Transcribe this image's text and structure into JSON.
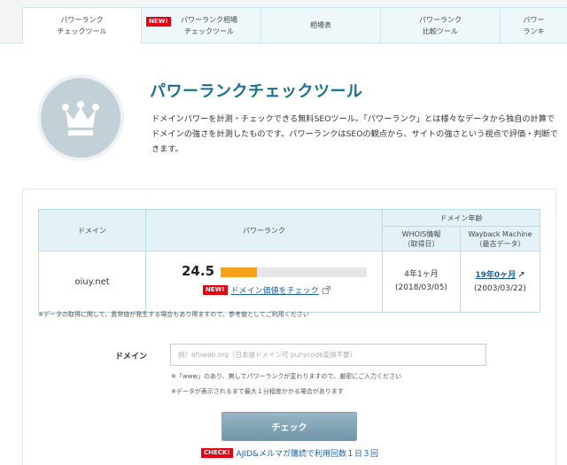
{
  "tabs": [
    {
      "label": "パワーランク\nチェックツール",
      "active": true,
      "new": false
    },
    {
      "label": "パワーランク相場\nチェックツール",
      "active": false,
      "new": true
    },
    {
      "label": "相場表",
      "active": false,
      "new": false
    },
    {
      "label": "パワーランク\n比較ツール",
      "active": false,
      "new": false
    },
    {
      "label": "パワー\nランキ",
      "active": false,
      "new": false
    }
  ],
  "badges": {
    "new": "NEW!",
    "check": "CHECK!"
  },
  "header": {
    "title": "パワーランクチェックツール",
    "description": "ドメインパワーを計測・チェックできる無料SEOツール。「パワーランク」とは様々なデータから独自の計算でドメインの強さを計測したものです。パワーランクはSEOの観点から、サイトの強さという視点で評価・判断できます。"
  },
  "table": {
    "headers": {
      "domain": "ドメイン",
      "power_rank": "パワーランク",
      "domain_age": "ドメイン年齢",
      "whois": "WHOIS情報\n（取得日）",
      "wayback": "Wayback Machine\n（最古データ）"
    },
    "row": {
      "domain": "oiuy.net",
      "score": "24.5",
      "score_fraction": 0.25,
      "check_link": "ドメイン価値をチェック",
      "whois_age": "4年1ヶ月",
      "whois_date": "(2018/03/05)",
      "wayback_age": "19年0ヶ月",
      "wayback_date": "(2003/03/22)"
    }
  },
  "notes": {
    "data_note": "※データの取得に関して、異常値が発生する場合もあり得ますので、参考値としてご利用ください",
    "www_note": "※「www」のあり、無しでパワーランクが変わりますので、厳密にご入力ください",
    "time_note": "※データが表示されるまで最大１分程度かかる場合があります"
  },
  "form": {
    "label": "ドメイン",
    "placeholder": "例）efoweb.org（日本語ドメイン可 punycode変換不要）",
    "button": "チェック"
  },
  "promo": {
    "text": "AJID&メルマガ購読で利用回数１日３回"
  },
  "colors": {
    "accent": "#1a6f8f",
    "bar": "#f5a11b",
    "new_badge": "#e60012",
    "link": "#1a5fa5"
  }
}
